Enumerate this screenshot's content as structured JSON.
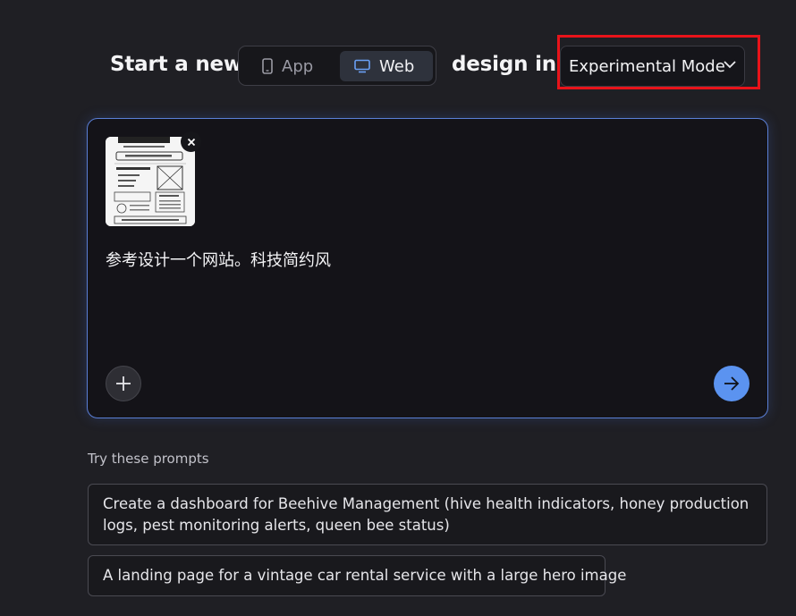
{
  "header": {
    "start_text": "Start a new",
    "design_text": "design in",
    "platform_options": [
      {
        "label": "App",
        "icon": "phone-icon",
        "selected": false
      },
      {
        "label": "Web",
        "icon": "monitor-icon",
        "selected": true
      }
    ],
    "mode_select": {
      "value": "Experimental Mode",
      "highlight_color": "#e8131a"
    }
  },
  "prompt": {
    "attachment_icon": "image-thumbnail",
    "text": "参考设计一个网站。科技简约风",
    "add_icon": "plus-icon",
    "send_icon": "arrow-right-icon",
    "send_color": "#5b93f0",
    "border_color": "#5a7fd6"
  },
  "suggestions": {
    "heading": "Try these prompts",
    "items": [
      "Create a dashboard for Beehive Management (hive health indicators, honey production logs, pest monitoring alerts, queen bee status)",
      "A landing page for a vintage car rental service with a large hero image"
    ]
  }
}
